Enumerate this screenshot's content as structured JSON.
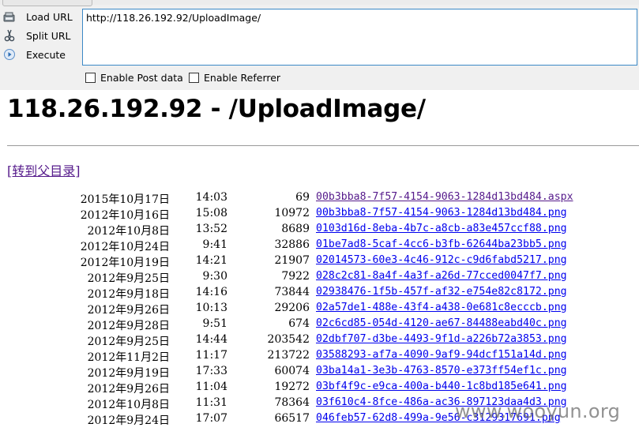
{
  "hackbar": {
    "load_url_label": "Load URL",
    "split_url_label": "Split URL",
    "execute_label": "Execute",
    "url_value": "http://118.26.192.92/UploadImage/",
    "enable_post_data_label": "Enable Post data",
    "enable_referrer_label": "Enable Referrer"
  },
  "page": {
    "title": "118.26.192.92 - /UploadImage/",
    "parent_link": "[转到父目录]"
  },
  "listing": [
    {
      "date": "2015年10月17日",
      "time": "14:03",
      "size": "69",
      "name": "00b3bba8-7f57-4154-9063-1284d13bd484.aspx"
    },
    {
      "date": "2012年10月16日",
      "time": "15:08",
      "size": "10972",
      "name": "00b3bba8-7f57-4154-9063-1284d13bd484.png"
    },
    {
      "date": "2012年10月8日",
      "time": "13:52",
      "size": "8689",
      "name": "0103d16d-8eba-4b7c-a8cb-a83e457ccf88.png"
    },
    {
      "date": "2012年10月24日",
      "time": "9:41",
      "size": "32886",
      "name": "01be7ad8-5caf-4cc6-b3fb-62644ba23bb5.png"
    },
    {
      "date": "2012年10月19日",
      "time": "14:21",
      "size": "21907",
      "name": "02014573-60e3-4c46-912c-c9d6fabd5217.png"
    },
    {
      "date": "2012年9月25日",
      "time": "9:30",
      "size": "7922",
      "name": "028c2c81-8a4f-4a3f-a26d-77cced0047f7.png"
    },
    {
      "date": "2012年9月18日",
      "time": "14:16",
      "size": "73844",
      "name": "02938476-1f5b-457f-af32-e754e82c8172.png"
    },
    {
      "date": "2012年9月26日",
      "time": "10:13",
      "size": "29206",
      "name": "02a57de1-488e-43f4-a438-0e681c8ecccb.png"
    },
    {
      "date": "2012年9月28日",
      "time": "9:51",
      "size": "674",
      "name": "02c6cd85-054d-4120-ae67-84488eabd40c.png"
    },
    {
      "date": "2012年9月25日",
      "time": "14:44",
      "size": "203542",
      "name": "02dbf707-d3be-4493-9f1d-a226b72a3853.png"
    },
    {
      "date": "2012年11月2日",
      "time": "11:17",
      "size": "213722",
      "name": "03588293-af7a-4090-9af9-94dcf151a14d.png"
    },
    {
      "date": "2012年9月19日",
      "time": "17:33",
      "size": "60074",
      "name": "03ba14a1-3e3b-4763-8570-e373ff54ef1c.png"
    },
    {
      "date": "2012年9月26日",
      "time": "11:04",
      "size": "19272",
      "name": "03bf4f9c-e9ca-400a-b440-1c8bd185e641.png"
    },
    {
      "date": "2012年10月8日",
      "time": "11:31",
      "size": "78364",
      "name": "03f610c4-8fce-486a-ac36-897123daa4d3.png"
    },
    {
      "date": "2012年9月24日",
      "time": "17:07",
      "size": "66517",
      "name": "046feb57-62d8-499a-9e56-c3129317691.png"
    }
  ],
  "watermark": "www.wooyun.org",
  "colors": {
    "link": "#0000ee",
    "visited_link": "#551a8b",
    "url_box_border": "#3b88c6",
    "toolbar_bg": "#f0f0f0"
  },
  "icons": {
    "load_url": "load-url-icon",
    "split_url": "split-url-icon",
    "execute": "execute-icon"
  }
}
